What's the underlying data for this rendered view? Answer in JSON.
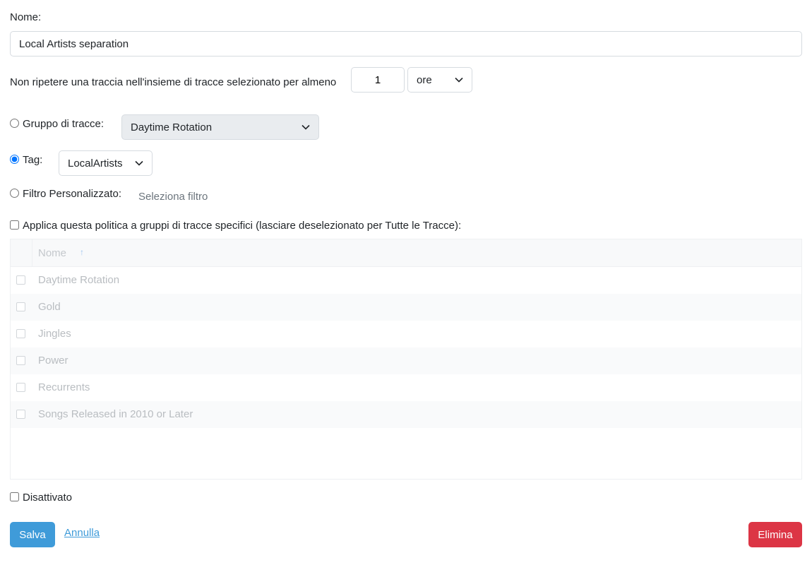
{
  "form": {
    "name_label": "Nome:",
    "name_value": "Local Artists separation",
    "repeat_text": "Non ripetere una traccia nell'insieme di tracce selezionato per almeno",
    "repeat_value": "1",
    "repeat_unit": "ore",
    "group_label": "Gruppo di tracce:",
    "group_value": "Daytime Rotation",
    "tag_label": "Tag:",
    "tag_value": "LocalArtists",
    "filter_label": "Filtro Personalizzato:",
    "filter_placeholder": "Seleziona filtro",
    "selected_option": "tag",
    "apply_label": "Applica questa politica a gruppi di tracce specifici (lasciare deselezionato per Tutte le Tracce):",
    "apply_checked": false,
    "disabled_label": "Disattivato",
    "disabled_checked": false
  },
  "table": {
    "header_name": "Nome",
    "sort_icon": "arrow-up-icon",
    "rows": [
      {
        "name": "Daytime Rotation"
      },
      {
        "name": "Gold"
      },
      {
        "name": "Jingles"
      },
      {
        "name": "Power"
      },
      {
        "name": "Recurrents"
      },
      {
        "name": "Songs Released in 2010 or Later"
      }
    ]
  },
  "actions": {
    "save_label": "Salva",
    "cancel_label": "Annulla",
    "delete_label": "Elimina"
  },
  "colors": {
    "primary": "#3f9bd9",
    "danger": "#dc3545",
    "disabled_text": "#b9bdc1"
  }
}
